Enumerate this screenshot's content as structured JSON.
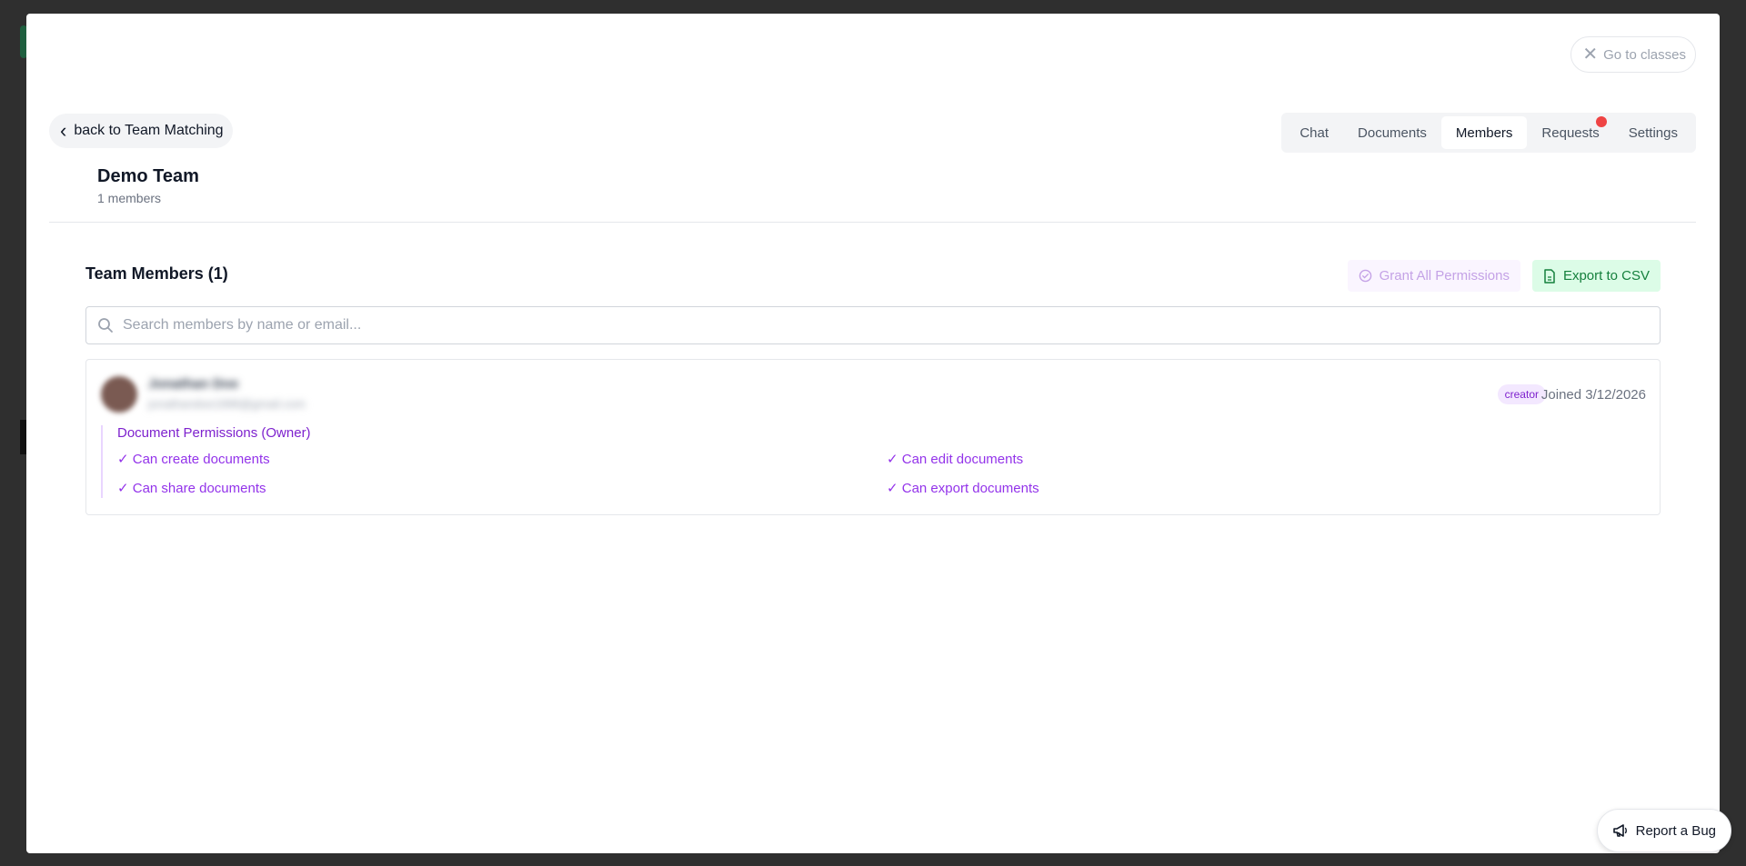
{
  "close_button": {
    "label": "Go to classes"
  },
  "back_button": {
    "label": "back to Team Matching"
  },
  "tabs": [
    {
      "label": "Chat"
    },
    {
      "label": "Documents"
    },
    {
      "label": "Members",
      "active": true
    },
    {
      "label": "Requests",
      "notification": true
    },
    {
      "label": "Settings"
    }
  ],
  "team": {
    "name": "Demo Team",
    "member_count": "1 members"
  },
  "members_section": {
    "title": "Team Members (1)",
    "grant_label": "Grant All Permissions",
    "export_label": "Export to CSV",
    "search_placeholder": "Search members by name or email..."
  },
  "member": {
    "name": "Jonathan Doe",
    "email": "jonathandoe1998@gmail.com",
    "role": "creator",
    "joined": "Joined 3/12/2026",
    "permissions_title": "Document Permissions (Owner)",
    "permissions": [
      "✓ Can create documents",
      "✓ Can edit documents",
      "✓ Can share documents",
      "✓ Can export documents"
    ]
  },
  "report_bug": {
    "label": "Report a Bug"
  },
  "colors": {
    "accent_purple": "#9333ea",
    "export_green": "#15803d",
    "notification_red": "#ef4444"
  }
}
